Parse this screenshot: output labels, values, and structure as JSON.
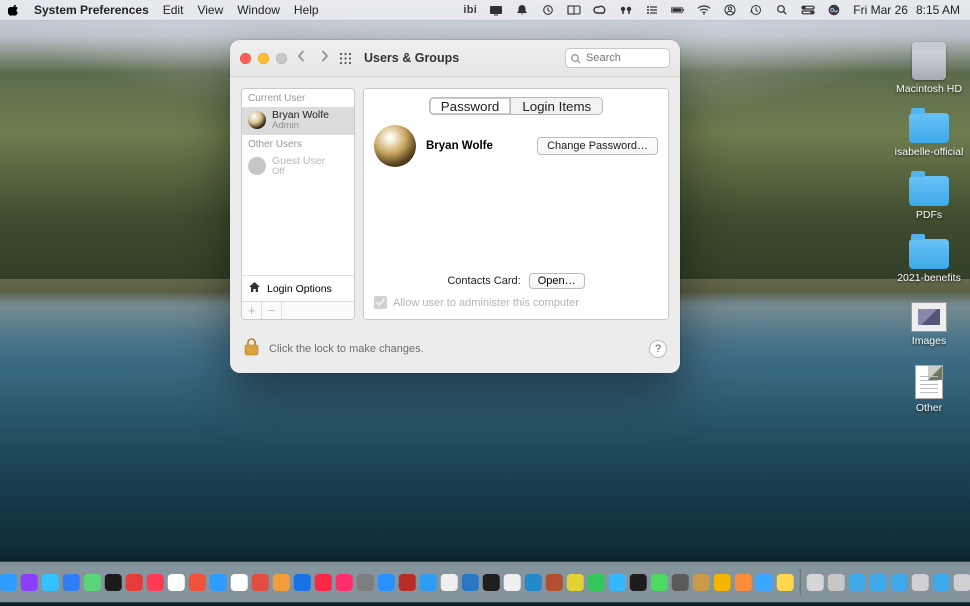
{
  "menubar": {
    "app_title": "System Preferences",
    "menus": [
      "Edit",
      "View",
      "Window",
      "Help"
    ],
    "clock_day": "Fri Mar 26",
    "clock_time": "8:15 AM",
    "status_ibi": "ibi"
  },
  "window": {
    "title": "Users & Groups",
    "search_placeholder": "Search",
    "sidebar": {
      "current_label": "Current User",
      "other_label": "Other Users",
      "current_user": {
        "name": "Bryan Wolfe",
        "role": "Admin"
      },
      "guest_user": {
        "name": "Guest User",
        "role": "Off"
      },
      "login_options": "Login Options"
    },
    "tabs": {
      "password": "Password",
      "login_items": "Login Items"
    },
    "profile": {
      "name": "Bryan Wolfe",
      "change_password": "Change Password…",
      "contacts_label": "Contacts Card:",
      "open": "Open…",
      "admin_checkbox": "Allow user to administer this computer"
    },
    "lockbar": {
      "text": "Click the lock to make changes.",
      "help": "?"
    }
  },
  "desktop": {
    "hd": "Macintosh HD",
    "folders": [
      "isabelle-official",
      "PDFs",
      "2021-benefits"
    ],
    "images": "Images",
    "other": "Other"
  },
  "dock": {
    "apps": [
      {
        "name": "finder",
        "color": "#2aa8f5"
      },
      {
        "name": "launchpad",
        "color": "#e7e9ef"
      },
      {
        "name": "safari",
        "color": "#2d9cff"
      },
      {
        "name": "podcasts",
        "color": "#8a3fff"
      },
      {
        "name": "shortcuts",
        "color": "#33c1ff"
      },
      {
        "name": "mail",
        "color": "#2f7ef5"
      },
      {
        "name": "maps",
        "color": "#5bd47a"
      },
      {
        "name": "wallet",
        "color": "#1b1b1b"
      },
      {
        "name": "fantastical",
        "color": "#e43b3b"
      },
      {
        "name": "news",
        "color": "#ff3a55"
      },
      {
        "name": "calendar",
        "color": "#ffffff"
      },
      {
        "name": "swift",
        "color": "#f05138"
      },
      {
        "name": "things",
        "color": "#2e9bff"
      },
      {
        "name": "health",
        "color": "#ffffff"
      },
      {
        "name": "bear",
        "color": "#e04c3e"
      },
      {
        "name": "shortcuts2",
        "color": "#f29d3a"
      },
      {
        "name": "1password",
        "color": "#1971e6"
      },
      {
        "name": "music",
        "color": "#fb2745"
      },
      {
        "name": "itunes",
        "color": "#ff2f6a"
      },
      {
        "name": "settings",
        "color": "#7d7d7d"
      },
      {
        "name": "appstore",
        "color": "#2b90ff"
      },
      {
        "name": "quora",
        "color": "#b92b27"
      },
      {
        "name": "fontbook",
        "color": "#2e9cf0"
      },
      {
        "name": "voicememos",
        "color": "#efefef"
      },
      {
        "name": "trello",
        "color": "#2b76c3"
      },
      {
        "name": "figma",
        "color": "#1e1e1e"
      },
      {
        "name": "iawriter",
        "color": "#efefef"
      },
      {
        "name": "vscode",
        "color": "#2489ca"
      },
      {
        "name": "word",
        "color": "#b24f2e"
      },
      {
        "name": "todoist",
        "color": "#e3d234"
      },
      {
        "name": "imessage",
        "color": "#34c759"
      },
      {
        "name": "tweetbot",
        "color": "#33b8ff"
      },
      {
        "name": "terminal",
        "color": "#1d1d1d"
      },
      {
        "name": "facetime",
        "color": "#4cd964"
      },
      {
        "name": "pixelmator",
        "color": "#5a5a5a"
      },
      {
        "name": "box",
        "color": "#c89a4a"
      },
      {
        "name": "slides",
        "color": "#f4b400"
      },
      {
        "name": "gifcap",
        "color": "#ff8c3a"
      },
      {
        "name": "capture",
        "color": "#3aa6ff"
      },
      {
        "name": "notes",
        "color": "#ffd84d"
      }
    ],
    "right": [
      {
        "name": "drafts",
        "color": "#d6d6d6"
      },
      {
        "name": "preview",
        "color": "#c7c7c7"
      },
      {
        "name": "folder1",
        "color": "#3ea9e8"
      },
      {
        "name": "screenshots",
        "color": "#3ea9e8"
      },
      {
        "name": "finder2",
        "color": "#3ea9e8"
      },
      {
        "name": "sysprefs",
        "color": "#cfcfd4"
      },
      {
        "name": "folder2",
        "color": "#3ea9e8"
      },
      {
        "name": "folder3",
        "color": "#cfcfd4"
      },
      {
        "name": "downloads",
        "color": "#3ea9e8"
      },
      {
        "name": "trash",
        "color": "#d8d8dd"
      }
    ]
  }
}
